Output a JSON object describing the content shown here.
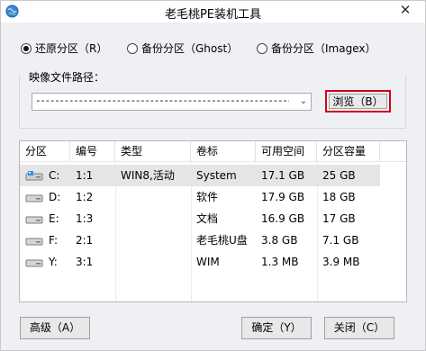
{
  "window": {
    "title": "老毛桃PE装机工具",
    "close_glyph": "✕",
    "app_icon": "globe-icon"
  },
  "mode": {
    "options": [
      {
        "label": "还原分区（R）",
        "checked": true
      },
      {
        "label": "备份分区（Ghost）",
        "checked": false
      },
      {
        "label": "备份分区（Imagex）",
        "checked": false
      }
    ]
  },
  "image_path": {
    "group_label": "映像文件路径：",
    "value": "------------------------------------------------------------------------------------------",
    "dropdown_glyph": "⌄",
    "browse_label": "浏览（B）",
    "browse_highlight_color": "#d0021b"
  },
  "partitions": {
    "columns": [
      "分区",
      "编号",
      "类型",
      "卷标",
      "可用空间",
      "分区容量"
    ],
    "rows": [
      {
        "drive": "C:",
        "number": "1:1",
        "type": "WIN8,活动",
        "label": "System",
        "free": "17.1 GB",
        "size": "25 GB",
        "icon": "windows-drive-icon",
        "selected": true
      },
      {
        "drive": "D:",
        "number": "1:2",
        "type": "",
        "label": "软件",
        "free": "17.9 GB",
        "size": "18 GB",
        "icon": "drive-icon",
        "selected": false
      },
      {
        "drive": "E:",
        "number": "1:3",
        "type": "",
        "label": "文档",
        "free": "16.9 GB",
        "size": "17 GB",
        "icon": "drive-icon",
        "selected": false
      },
      {
        "drive": "F:",
        "number": "2:1",
        "type": "",
        "label": "老毛桃U盘",
        "free": "3.8 GB",
        "size": "7.1 GB",
        "icon": "drive-icon",
        "selected": false
      },
      {
        "drive": "Y:",
        "number": "3:1",
        "type": "",
        "label": "WIM",
        "free": "1.3 MB",
        "size": "3.9 MB",
        "icon": "drive-icon",
        "selected": false
      }
    ]
  },
  "footer": {
    "advanced_label": "高级（A）",
    "ok_label": "确定（Y）",
    "close_label": "关闭（C）"
  }
}
